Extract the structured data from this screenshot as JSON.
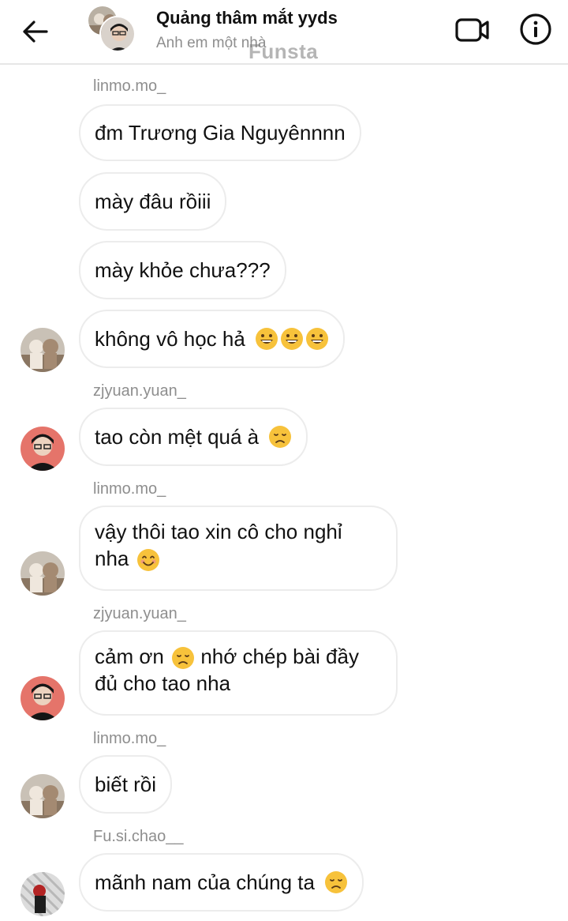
{
  "header": {
    "title": "Quảng thâm mắt yyds",
    "subtitle": "Anh em một nhà",
    "watermark": "Funsta"
  },
  "colors": {
    "border": "#e6e6e6",
    "bubble_border": "#ececec",
    "secondary_text": "#8e8e8e",
    "emoji_yellow": "#f7c23b"
  },
  "icons": {
    "back": "arrow-left-icon",
    "video": "video-camera-icon",
    "info": "info-icon"
  },
  "messages": [
    {
      "sender": "linmo.mo_"
    },
    {
      "text": "đm Trương Gia Nguyênnnn"
    },
    {
      "text": "mày đâu rồiii"
    },
    {
      "text": "mày khỏe chưa???"
    },
    {
      "text": "không vô học hả",
      "emoji": "grinning-face x3"
    },
    {
      "sender": "zjyuan.yuan_"
    },
    {
      "text": "tao còn mệt quá à",
      "emoji": "disappointed-face"
    },
    {
      "sender": "linmo.mo_"
    },
    {
      "text_line1": "vậy thôi tao xin cô cho nghỉ",
      "text_line2": "nha",
      "emoji": "smiling-face"
    },
    {
      "sender": "zjyuan.yuan_"
    },
    {
      "text_part1": "cảm ơn",
      "text_part2": "nhớ chép bài đầy",
      "text_line2": "đủ cho tao nha",
      "emoji": "disappointed-face"
    },
    {
      "sender": "linmo.mo_"
    },
    {
      "text": "biết rồi"
    },
    {
      "sender": "Fu.si.chao__"
    },
    {
      "text": "mãnh nam của chúng ta",
      "emoji": "disappointed-face"
    }
  ]
}
